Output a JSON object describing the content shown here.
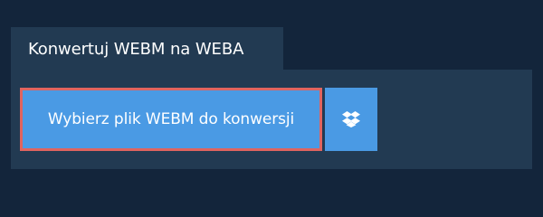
{
  "tab": {
    "title": "Konwertuj WEBM na WEBA"
  },
  "upload": {
    "choose_label": "Wybierz plik WEBM do konwersji",
    "dropbox_icon": "dropbox-icon"
  },
  "colors": {
    "page_background": "#13253b",
    "panel_background": "#223a52",
    "button_background": "#4a9ae4",
    "focus_outline": "#e0645f",
    "text": "#ffffff"
  }
}
